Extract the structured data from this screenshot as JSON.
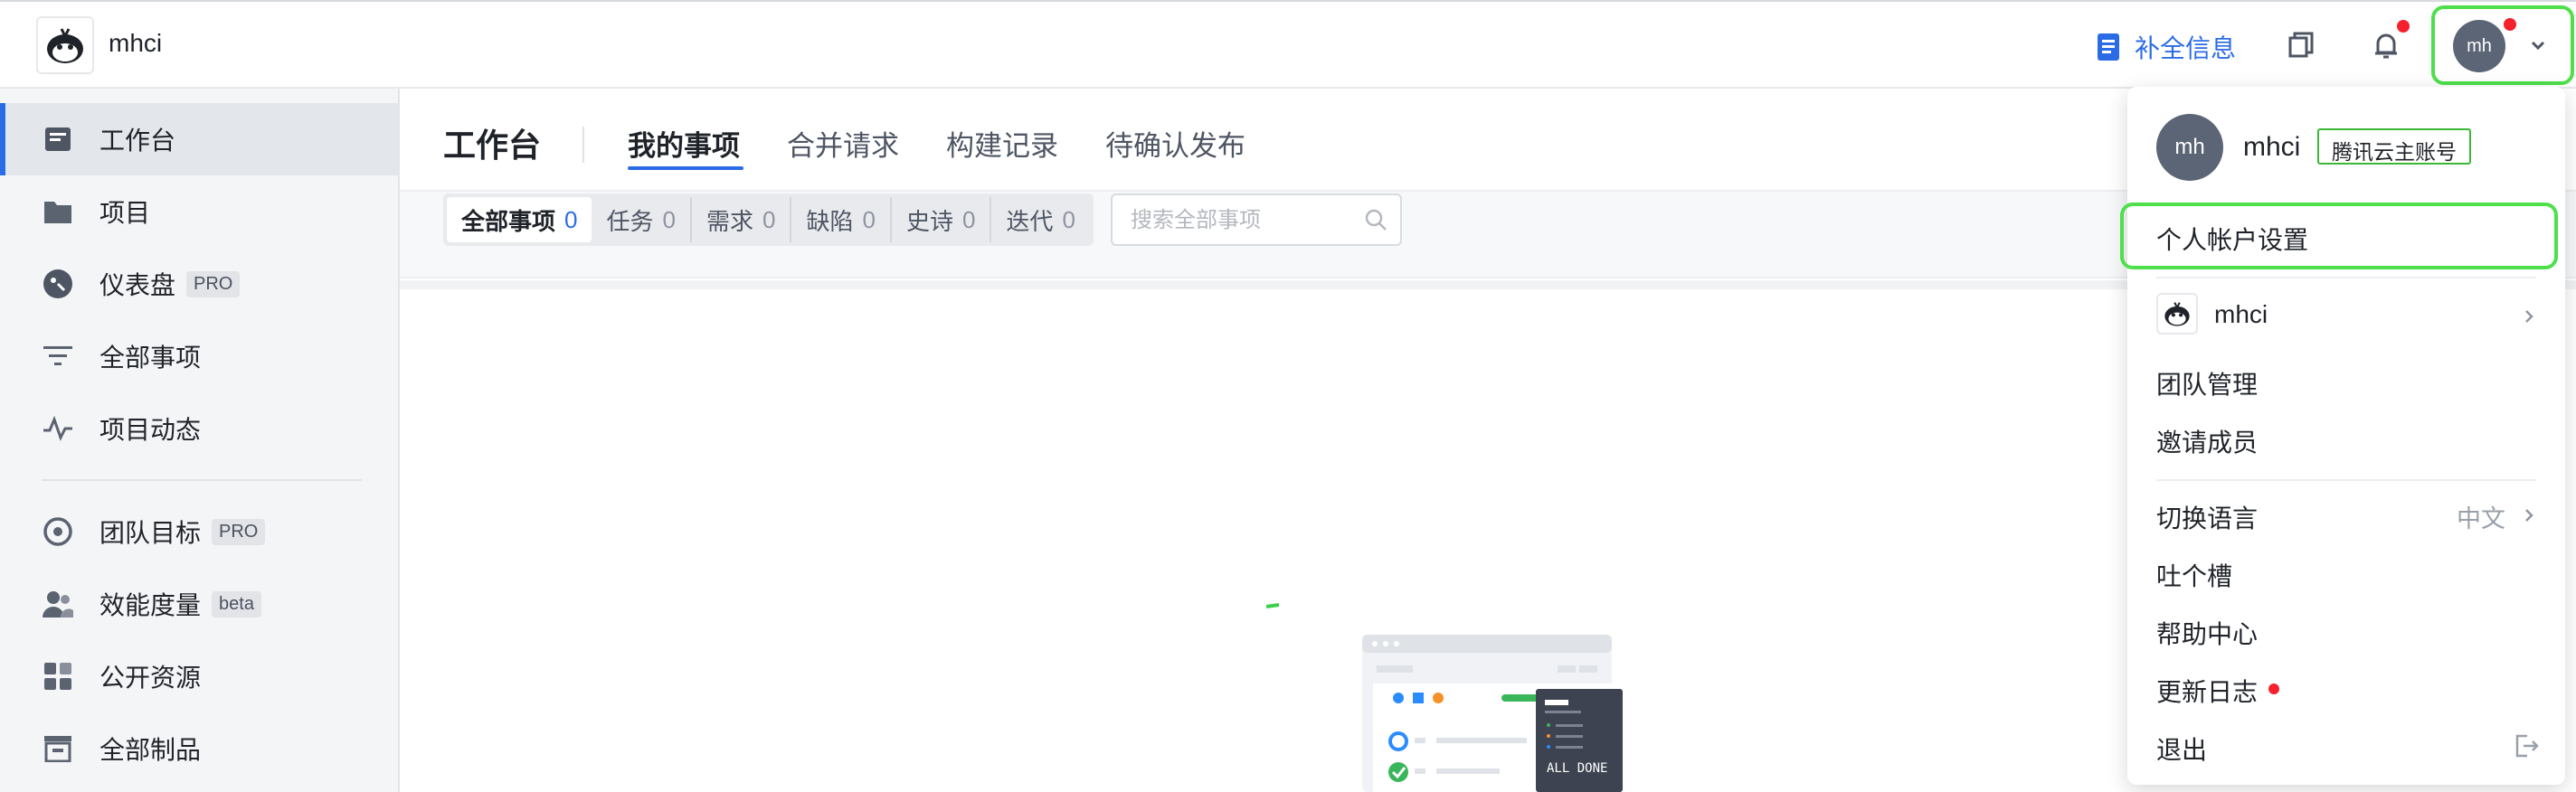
{
  "header": {
    "team_name": "mhci",
    "complete_info_label": "补全信息",
    "user_initials": "mh"
  },
  "sidebar": {
    "items": [
      {
        "label": "工作台",
        "icon": "workbench-icon"
      },
      {
        "label": "项目",
        "icon": "folder-icon"
      },
      {
        "label": "仪表盘",
        "icon": "dashboard-icon",
        "badge": "PRO"
      },
      {
        "label": "全部事项",
        "icon": "filter-list-icon"
      },
      {
        "label": "项目动态",
        "icon": "activity-icon"
      },
      {
        "label": "团队目标",
        "icon": "target-icon",
        "badge": "PRO"
      },
      {
        "label": "效能度量",
        "icon": "team-metrics-icon",
        "badge": "beta"
      },
      {
        "label": "公开资源",
        "icon": "apps-icon"
      },
      {
        "label": "全部制品",
        "icon": "artifact-icon"
      }
    ]
  },
  "main": {
    "page_title": "工作台",
    "tabs": [
      "我的事项",
      "合并请求",
      "构建记录",
      "待确认发布"
    ],
    "filters": [
      {
        "label": "全部事项",
        "count": "0"
      },
      {
        "label": "任务",
        "count": "0"
      },
      {
        "label": "需求",
        "count": "0"
      },
      {
        "label": "缺陷",
        "count": "0"
      },
      {
        "label": "史诗",
        "count": "0"
      },
      {
        "label": "迭代",
        "count": "0"
      }
    ],
    "search_placeholder": "搜索全部事项",
    "illustration_text": "ALL DONE"
  },
  "dropdown": {
    "user_initials": "mh",
    "user_name": "mhci",
    "account_badge": "腾讯云主账号",
    "account_settings": "个人帐户设置",
    "team_name": "mhci",
    "team_manage": "团队管理",
    "invite_members": "邀请成员",
    "switch_language": "切换语言",
    "language_value": "中文",
    "feedback": "吐个槽",
    "help_center": "帮助中心",
    "changelog": "更新日志",
    "logout": "退出"
  },
  "colors": {
    "accent": "#2b6ce6",
    "highlight": "#4ee04a",
    "notification": "#f5222d"
  }
}
